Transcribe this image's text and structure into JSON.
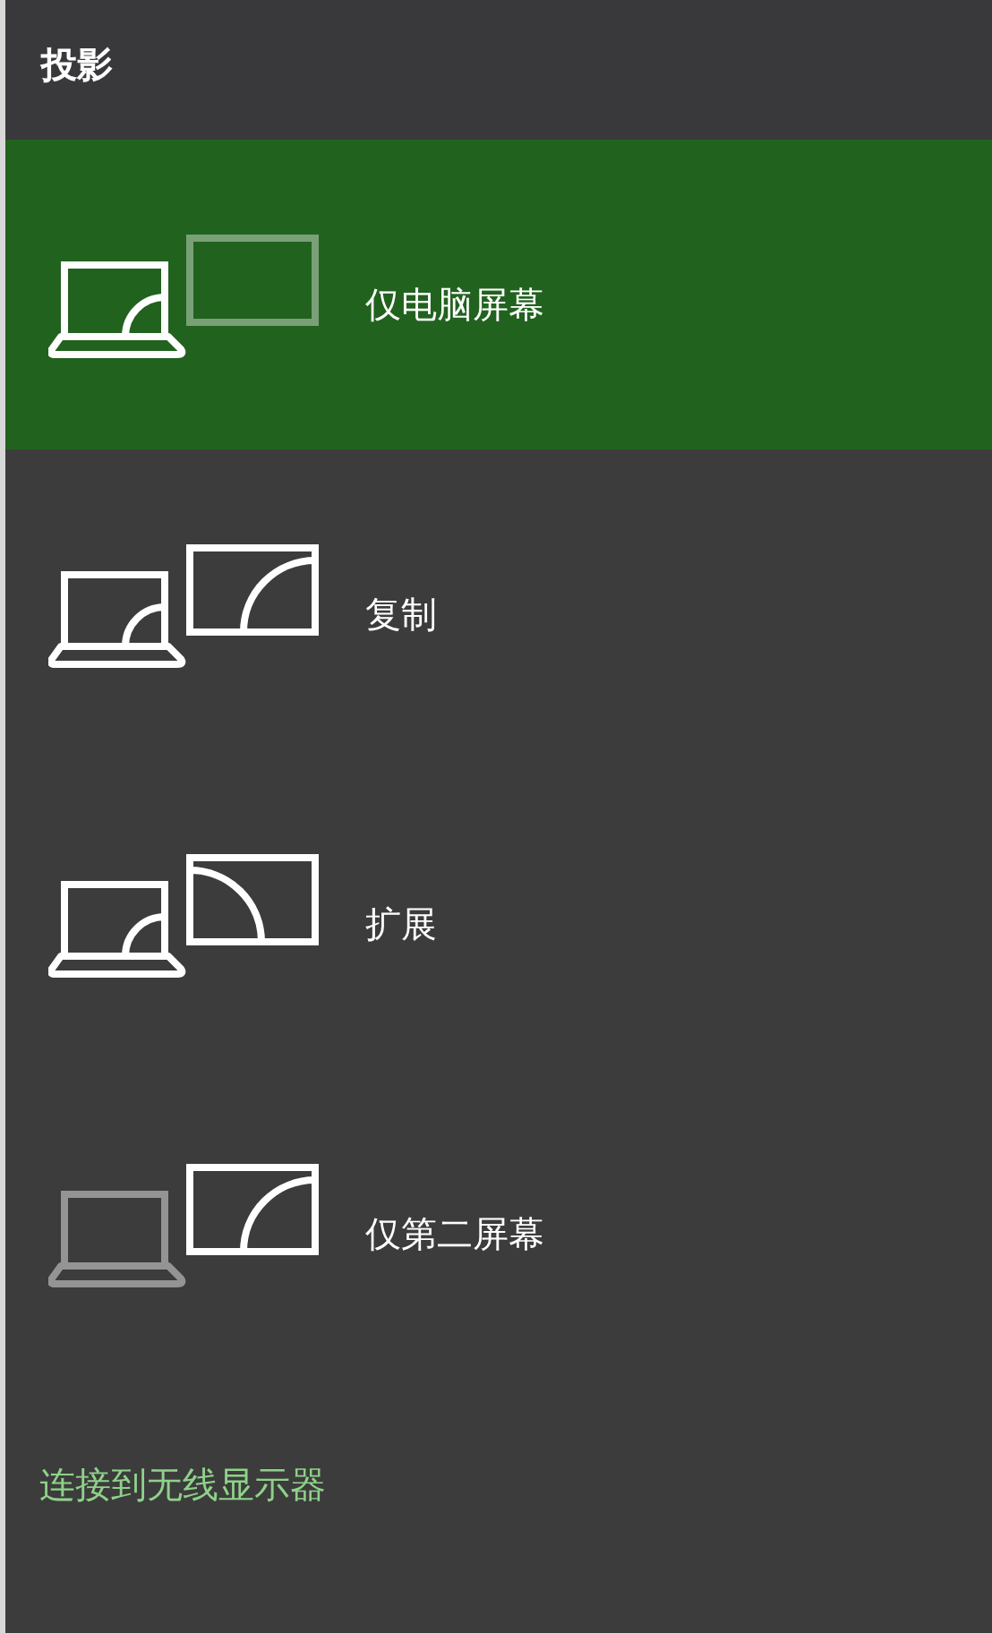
{
  "title": "投影",
  "options": [
    {
      "kind": "pc_only",
      "label": "仅电脑屏幕",
      "selected": true
    },
    {
      "kind": "duplicate",
      "label": "复制",
      "selected": false
    },
    {
      "kind": "extend",
      "label": "扩展",
      "selected": false
    },
    {
      "kind": "second_only",
      "label": "仅第二屏幕",
      "selected": false
    }
  ],
  "link": "连接到无线显示器"
}
